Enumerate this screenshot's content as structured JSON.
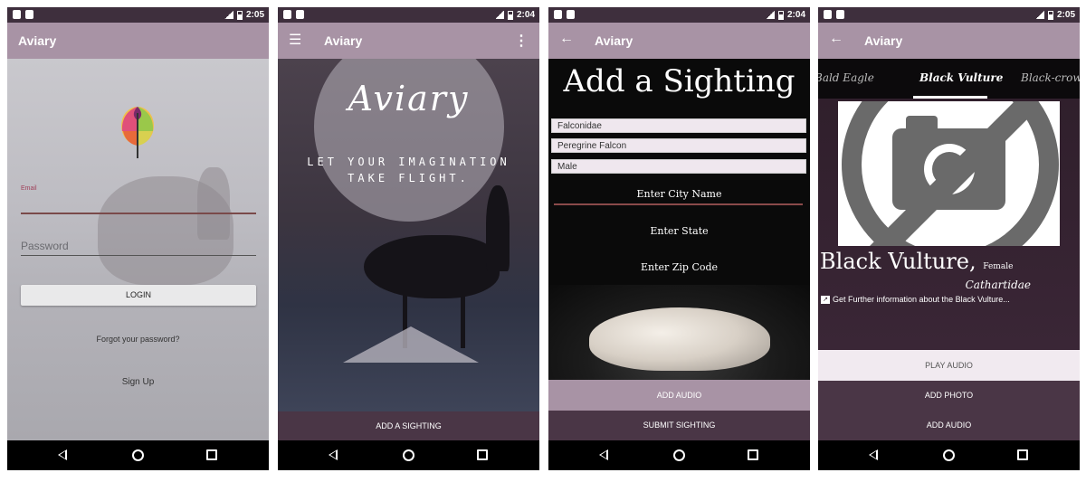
{
  "status": {
    "time_1": "2:05",
    "time_2": "2:04",
    "time_3": "2:04",
    "time_4": "2:05"
  },
  "app": {
    "title": "Aviary"
  },
  "login": {
    "email_label": "Email",
    "password_placeholder": "Password",
    "login_label": "LOGIN",
    "forgot_label": "Forgot your password?",
    "signup_label": "Sign Up"
  },
  "splash": {
    "logo_text": "Aviary",
    "tagline_1": "LET YOUR IMAGINATION",
    "tagline_2": "TAKE FLIGHT.",
    "add_button": "ADD A SIGHTING"
  },
  "add_sighting": {
    "heading": "Add a Sighting",
    "fields": [
      "Falconidae",
      "Peregrine Falcon",
      "Male"
    ],
    "city_placeholder": "Enter City Name",
    "state_placeholder": "Enter State",
    "zip_placeholder": "Enter Zip Code",
    "add_audio": "ADD AUDIO",
    "submit": "SUBMIT SIGHTING"
  },
  "detail": {
    "tabs": [
      "Bald Eagle",
      "Black Vulture",
      "Black-crowned"
    ],
    "active_tab": 1,
    "bird_name": "Black Vulture,",
    "sex": "Female",
    "family": "Cathartidae",
    "info_link": "Get Further information about the Black Vulture...",
    "play_audio": "PLAY AUDIO",
    "add_photo": "ADD PHOTO",
    "add_audio": "ADD AUDIO"
  }
}
